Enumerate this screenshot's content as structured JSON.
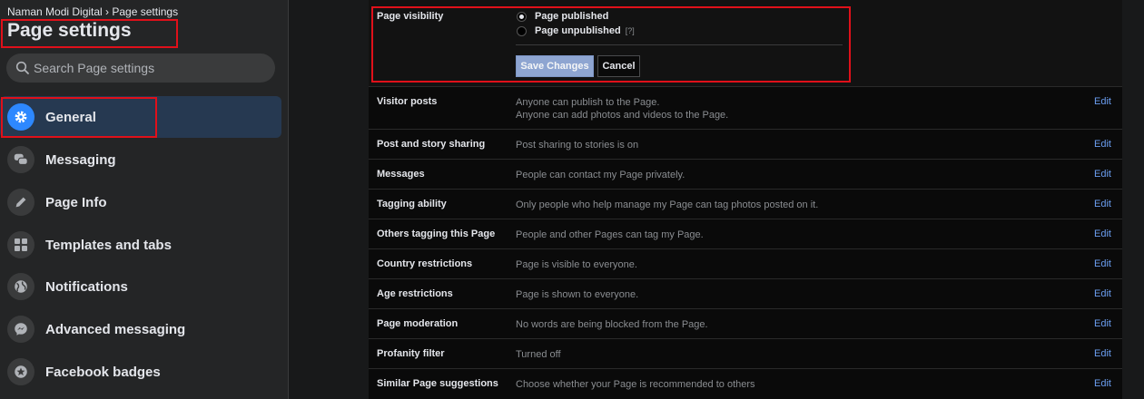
{
  "breadcrumb": "Naman Modi Digital › Page settings",
  "page_title": "Page settings",
  "search": {
    "placeholder": "Search Page settings"
  },
  "nav": [
    {
      "label": "General",
      "icon": "gear-icon",
      "active": true
    },
    {
      "label": "Messaging",
      "icon": "chat-bubbles-icon"
    },
    {
      "label": "Page Info",
      "icon": "pencil-icon"
    },
    {
      "label": "Templates and tabs",
      "icon": "grid-icon"
    },
    {
      "label": "Notifications",
      "icon": "globe-icon"
    },
    {
      "label": "Advanced messaging",
      "icon": "messenger-icon"
    },
    {
      "label": "Facebook badges",
      "icon": "star-badge-icon"
    }
  ],
  "visibility": {
    "label": "Page visibility",
    "published": "Page published",
    "unpublished": "Page unpublished",
    "help": "[?]",
    "save_label": "Save Changes",
    "cancel_label": "Cancel",
    "selected": "published"
  },
  "settings": [
    {
      "label": "Visitor posts",
      "desc": [
        "Anyone can publish to the Page.",
        "Anyone can add photos and videos to the Page."
      ],
      "edit": "Edit"
    },
    {
      "label": "Post and story sharing",
      "desc": [
        "Post sharing to stories is on"
      ],
      "edit": "Edit"
    },
    {
      "label": "Messages",
      "desc": [
        "People can contact my Page privately."
      ],
      "edit": "Edit"
    },
    {
      "label": "Tagging ability",
      "desc": [
        "Only people who help manage my Page can tag photos posted on it."
      ],
      "edit": "Edit"
    },
    {
      "label": "Others tagging this Page",
      "desc": [
        "People and other Pages can tag my Page."
      ],
      "edit": "Edit"
    },
    {
      "label": "Country restrictions",
      "desc": [
        "Page is visible to everyone."
      ],
      "edit": "Edit"
    },
    {
      "label": "Age restrictions",
      "desc": [
        "Page is shown to everyone."
      ],
      "edit": "Edit"
    },
    {
      "label": "Page moderation",
      "desc": [
        "No words are being blocked from the Page."
      ],
      "edit": "Edit"
    },
    {
      "label": "Profanity filter",
      "desc": [
        "Turned off"
      ],
      "edit": "Edit"
    },
    {
      "label": "Similar Page suggestions",
      "desc": [
        "Choose whether your Page is recommended to others"
      ],
      "edit": "Edit"
    }
  ],
  "colors": {
    "accent": "#2d88ff",
    "highlight": "#e0101a",
    "link": "#6b9ef0"
  }
}
